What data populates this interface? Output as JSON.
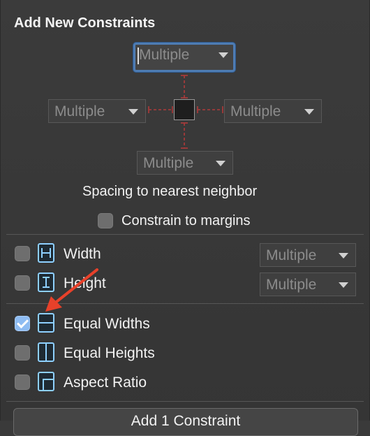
{
  "panel": {
    "title": "Add New Constraints",
    "spacing": {
      "top": "Multiple",
      "left": "Multiple",
      "right": "Multiple",
      "bottom": "Multiple",
      "caption": "Spacing to nearest neighbor"
    },
    "constrain_margins": {
      "label": "Constrain to margins",
      "checked": false
    },
    "size_rows": [
      {
        "label": "Width",
        "value": "Multiple",
        "checked": false,
        "icon": "width-icon"
      },
      {
        "label": "Height",
        "value": "Multiple",
        "checked": false,
        "icon": "height-icon"
      }
    ],
    "equal_rows": [
      {
        "label": "Equal Widths",
        "checked": true,
        "icon": "equal-widths-icon"
      },
      {
        "label": "Equal Heights",
        "checked": false,
        "icon": "equal-heights-icon"
      },
      {
        "label": "Aspect Ratio",
        "checked": false,
        "icon": "aspect-ratio-icon"
      }
    ],
    "add_button": "Add 1 Constraint",
    "colors": {
      "focus_ring": "#4e7cb3",
      "strut": "#b03a3a",
      "checkbox_checked": "#8ebcf2",
      "icon_stroke": "#8ed0ff",
      "annotation_arrow": "#e8412a"
    }
  }
}
